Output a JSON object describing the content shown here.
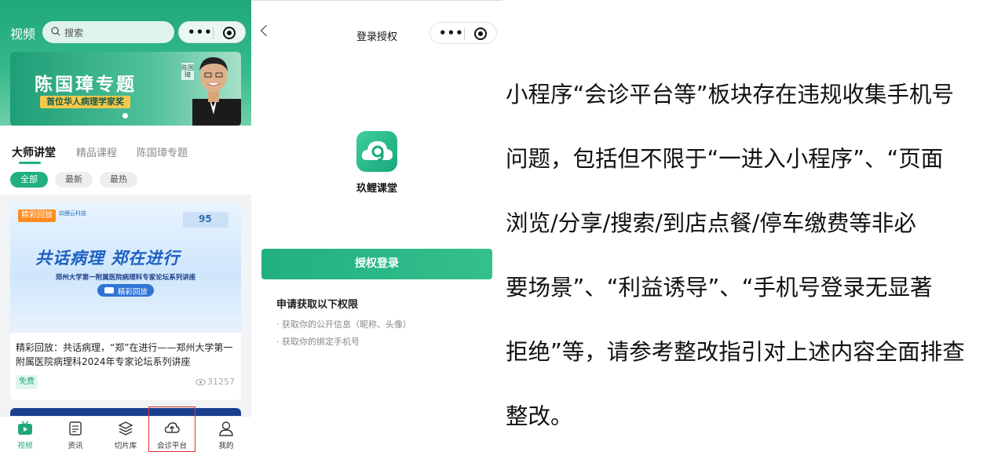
{
  "p1": {
    "nav_title": "视频",
    "search_placeholder": "搜索",
    "banner_title": "陈国璋专题",
    "banner_sub": "首位华人病理学家奖",
    "banner_name": "陈国璋",
    "tabs": [
      "大师讲堂",
      "精品课程",
      "陈国璋专题"
    ],
    "chips": [
      "全部",
      "最新",
      "最热"
    ],
    "card": {
      "badge": "精彩回放",
      "logo_text": "玖鲤云科技",
      "thumb_number": "95",
      "thumb_title": "共话病理 郑在进行",
      "thumb_line": "郑州大学第一附属医院病理科专家论坛系列讲座",
      "thumb_pill": "精彩回放",
      "title": "精彩回放：共话病理，“郑”在进行——郑州大学第一附属医院病理科2024年专家论坛系列讲座",
      "price": "免费",
      "views": "31257"
    },
    "tabbar": [
      "视频",
      "资讯",
      "切片库",
      "会诊平台",
      "我的"
    ],
    "accent": "#1fa77a",
    "highlight": "#e03030"
  },
  "p2": {
    "title": "登录授权",
    "app_name": "玖鲤课堂",
    "login_button": "授权登录",
    "perm_title": "申请获取以下权限",
    "perms": [
      "· 获取你的公开信息（昵称、头像）",
      "· 获取你的绑定手机号"
    ]
  },
  "p3": {
    "lines": [
      "小程序“会诊平台等”板块存在违规收集手机号",
      "问题，包括但不限于“一进入小程序”、“页面",
      "浏览/分享/搜索/到店点餐/停车缴费等非必",
      "要场景”、“利益诱导”、“手机号登录无显著",
      "拒绝”等，请参考整改指引对上述内容全面排查",
      "整改。"
    ]
  }
}
